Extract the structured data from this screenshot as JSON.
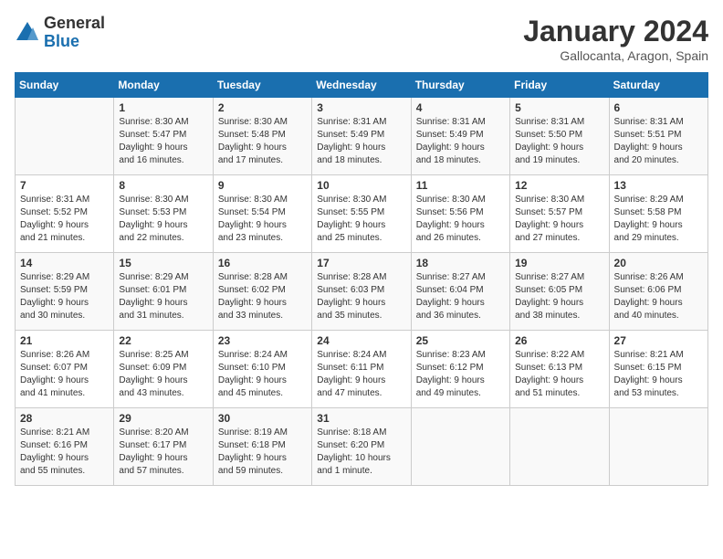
{
  "header": {
    "logo_general": "General",
    "logo_blue": "Blue",
    "title": "January 2024",
    "location": "Gallocanta, Aragon, Spain"
  },
  "days_of_week": [
    "Sunday",
    "Monday",
    "Tuesday",
    "Wednesday",
    "Thursday",
    "Friday",
    "Saturday"
  ],
  "weeks": [
    [
      {
        "num": "",
        "text": ""
      },
      {
        "num": "1",
        "text": "Sunrise: 8:30 AM\nSunset: 5:47 PM\nDaylight: 9 hours\nand 16 minutes."
      },
      {
        "num": "2",
        "text": "Sunrise: 8:30 AM\nSunset: 5:48 PM\nDaylight: 9 hours\nand 17 minutes."
      },
      {
        "num": "3",
        "text": "Sunrise: 8:31 AM\nSunset: 5:49 PM\nDaylight: 9 hours\nand 18 minutes."
      },
      {
        "num": "4",
        "text": "Sunrise: 8:31 AM\nSunset: 5:49 PM\nDaylight: 9 hours\nand 18 minutes."
      },
      {
        "num": "5",
        "text": "Sunrise: 8:31 AM\nSunset: 5:50 PM\nDaylight: 9 hours\nand 19 minutes."
      },
      {
        "num": "6",
        "text": "Sunrise: 8:31 AM\nSunset: 5:51 PM\nDaylight: 9 hours\nand 20 minutes."
      }
    ],
    [
      {
        "num": "7",
        "text": "Sunrise: 8:31 AM\nSunset: 5:52 PM\nDaylight: 9 hours\nand 21 minutes."
      },
      {
        "num": "8",
        "text": "Sunrise: 8:30 AM\nSunset: 5:53 PM\nDaylight: 9 hours\nand 22 minutes."
      },
      {
        "num": "9",
        "text": "Sunrise: 8:30 AM\nSunset: 5:54 PM\nDaylight: 9 hours\nand 23 minutes."
      },
      {
        "num": "10",
        "text": "Sunrise: 8:30 AM\nSunset: 5:55 PM\nDaylight: 9 hours\nand 25 minutes."
      },
      {
        "num": "11",
        "text": "Sunrise: 8:30 AM\nSunset: 5:56 PM\nDaylight: 9 hours\nand 26 minutes."
      },
      {
        "num": "12",
        "text": "Sunrise: 8:30 AM\nSunset: 5:57 PM\nDaylight: 9 hours\nand 27 minutes."
      },
      {
        "num": "13",
        "text": "Sunrise: 8:29 AM\nSunset: 5:58 PM\nDaylight: 9 hours\nand 29 minutes."
      }
    ],
    [
      {
        "num": "14",
        "text": "Sunrise: 8:29 AM\nSunset: 5:59 PM\nDaylight: 9 hours\nand 30 minutes."
      },
      {
        "num": "15",
        "text": "Sunrise: 8:29 AM\nSunset: 6:01 PM\nDaylight: 9 hours\nand 31 minutes."
      },
      {
        "num": "16",
        "text": "Sunrise: 8:28 AM\nSunset: 6:02 PM\nDaylight: 9 hours\nand 33 minutes."
      },
      {
        "num": "17",
        "text": "Sunrise: 8:28 AM\nSunset: 6:03 PM\nDaylight: 9 hours\nand 35 minutes."
      },
      {
        "num": "18",
        "text": "Sunrise: 8:27 AM\nSunset: 6:04 PM\nDaylight: 9 hours\nand 36 minutes."
      },
      {
        "num": "19",
        "text": "Sunrise: 8:27 AM\nSunset: 6:05 PM\nDaylight: 9 hours\nand 38 minutes."
      },
      {
        "num": "20",
        "text": "Sunrise: 8:26 AM\nSunset: 6:06 PM\nDaylight: 9 hours\nand 40 minutes."
      }
    ],
    [
      {
        "num": "21",
        "text": "Sunrise: 8:26 AM\nSunset: 6:07 PM\nDaylight: 9 hours\nand 41 minutes."
      },
      {
        "num": "22",
        "text": "Sunrise: 8:25 AM\nSunset: 6:09 PM\nDaylight: 9 hours\nand 43 minutes."
      },
      {
        "num": "23",
        "text": "Sunrise: 8:24 AM\nSunset: 6:10 PM\nDaylight: 9 hours\nand 45 minutes."
      },
      {
        "num": "24",
        "text": "Sunrise: 8:24 AM\nSunset: 6:11 PM\nDaylight: 9 hours\nand 47 minutes."
      },
      {
        "num": "25",
        "text": "Sunrise: 8:23 AM\nSunset: 6:12 PM\nDaylight: 9 hours\nand 49 minutes."
      },
      {
        "num": "26",
        "text": "Sunrise: 8:22 AM\nSunset: 6:13 PM\nDaylight: 9 hours\nand 51 minutes."
      },
      {
        "num": "27",
        "text": "Sunrise: 8:21 AM\nSunset: 6:15 PM\nDaylight: 9 hours\nand 53 minutes."
      }
    ],
    [
      {
        "num": "28",
        "text": "Sunrise: 8:21 AM\nSunset: 6:16 PM\nDaylight: 9 hours\nand 55 minutes."
      },
      {
        "num": "29",
        "text": "Sunrise: 8:20 AM\nSunset: 6:17 PM\nDaylight: 9 hours\nand 57 minutes."
      },
      {
        "num": "30",
        "text": "Sunrise: 8:19 AM\nSunset: 6:18 PM\nDaylight: 9 hours\nand 59 minutes."
      },
      {
        "num": "31",
        "text": "Sunrise: 8:18 AM\nSunset: 6:20 PM\nDaylight: 10 hours\nand 1 minute."
      },
      {
        "num": "",
        "text": ""
      },
      {
        "num": "",
        "text": ""
      },
      {
        "num": "",
        "text": ""
      }
    ]
  ]
}
